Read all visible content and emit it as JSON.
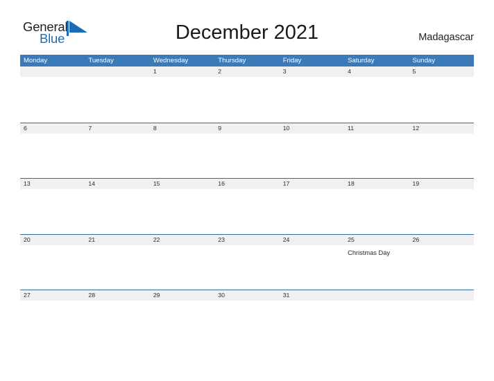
{
  "brand": {
    "name_part1": "General",
    "name_part2": "Blue",
    "flag_icon": "flag-triangle-icon",
    "color_dark": "#231f20",
    "color_blue": "#1b6cb5"
  },
  "header": {
    "title": "December 2021",
    "country": "Madagascar"
  },
  "calendar": {
    "accent_color": "#3b79b8",
    "band_color": "#f0f0f0",
    "rule_color": "#2e6da4",
    "weekdays": [
      "Monday",
      "Tuesday",
      "Wednesday",
      "Thursday",
      "Friday",
      "Saturday",
      "Sunday"
    ],
    "weeks": [
      [
        {
          "day": ""
        },
        {
          "day": ""
        },
        {
          "day": "1"
        },
        {
          "day": "2"
        },
        {
          "day": "3"
        },
        {
          "day": "4"
        },
        {
          "day": "5"
        }
      ],
      [
        {
          "day": "6"
        },
        {
          "day": "7"
        },
        {
          "day": "8"
        },
        {
          "day": "9"
        },
        {
          "day": "10"
        },
        {
          "day": "11"
        },
        {
          "day": "12"
        }
      ],
      [
        {
          "day": "13"
        },
        {
          "day": "14"
        },
        {
          "day": "15"
        },
        {
          "day": "16"
        },
        {
          "day": "17"
        },
        {
          "day": "18"
        },
        {
          "day": "19"
        }
      ],
      [
        {
          "day": "20"
        },
        {
          "day": "21"
        },
        {
          "day": "22"
        },
        {
          "day": "23"
        },
        {
          "day": "24"
        },
        {
          "day": "25",
          "event": "Christmas Day"
        },
        {
          "day": "26"
        }
      ],
      [
        {
          "day": "27"
        },
        {
          "day": "28"
        },
        {
          "day": "29"
        },
        {
          "day": "30"
        },
        {
          "day": "31"
        },
        {
          "day": ""
        },
        {
          "day": ""
        }
      ]
    ]
  }
}
